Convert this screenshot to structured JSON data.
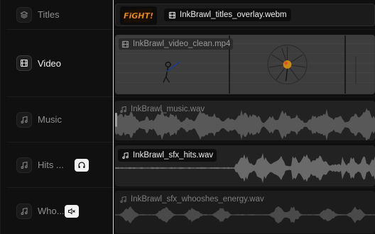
{
  "tracks": [
    {
      "id": "titles",
      "label": "Titles",
      "icon": "layers-icon",
      "active": false
    },
    {
      "id": "video",
      "label": "Video",
      "icon": "film-icon",
      "active": true
    },
    {
      "id": "music",
      "label": "Music",
      "icon": "music-note-icon",
      "active": false
    },
    {
      "id": "hits",
      "label": "Hits ...",
      "icon": "music-note-icon",
      "active": false,
      "toggle_icon": "headphones-icon"
    },
    {
      "id": "whooshes",
      "label": "Who...",
      "icon": "music-note-icon",
      "active": false,
      "toggle_icon": "speaker-muted-icon"
    }
  ],
  "clips": {
    "titles": {
      "file": "InkBrawl_titles_overlay.webm",
      "logo_text": "FiGHT!"
    },
    "video": {
      "file": "InkBrawl_video_clean.mp4"
    },
    "music": {
      "file": "InkBrawl_music.wav"
    },
    "hits": {
      "file": "InkBrawl_sfx_hits.wav"
    },
    "whooshes": {
      "file": "InkBrawl_sfx_whooshes_energy.wav"
    }
  },
  "colors": {
    "background": "#0b0b0b",
    "panel": "#101010",
    "clip_audio": "#222222",
    "waveform": "#5a5a5a",
    "waveform_bright": "#6e6e6e",
    "logo_orange": "#f0a020"
  }
}
